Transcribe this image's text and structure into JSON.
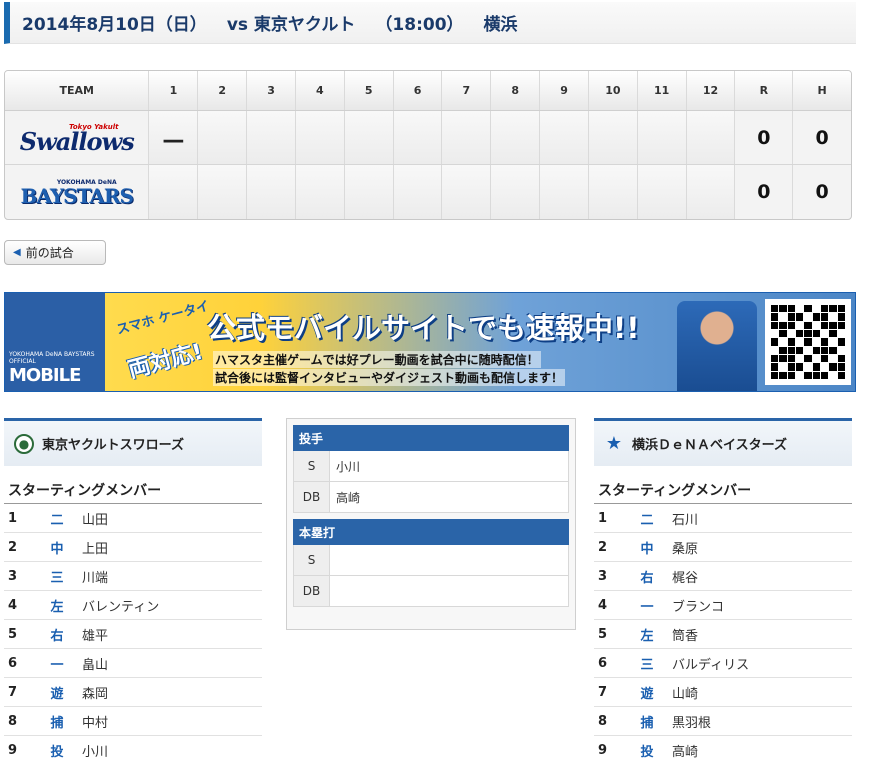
{
  "header": {
    "date": "2014年8月10日（日）",
    "opponent": "vs 東京ヤクルト",
    "time": "（18:00）",
    "venue": "横浜"
  },
  "scoreboard": {
    "columns": [
      "TEAM",
      "1",
      "2",
      "3",
      "4",
      "5",
      "6",
      "7",
      "8",
      "9",
      "10",
      "11",
      "12",
      "R",
      "H"
    ],
    "teams": [
      {
        "logo_top": "Tokyo Yakult",
        "logo_main": "Swallows",
        "innings": [
          "—",
          "",
          "",
          "",
          "",
          "",
          "",
          "",
          "",
          "",
          "",
          ""
        ],
        "runs": "0",
        "hits": "0"
      },
      {
        "logo_top": "YOKOHAMA DeNA",
        "logo_main": "BAYSTARS",
        "innings": [
          "",
          "",
          "",
          "",
          "",
          "",
          "",
          "",
          "",
          "",
          "",
          ""
        ],
        "runs": "0",
        "hits": "0"
      }
    ]
  },
  "prev_button": {
    "label": "前の試合"
  },
  "banner": {
    "mobile_small": "YOKOHAMA DeNA BAYSTARS OFFICIAL",
    "mobile_big": "MOBILE",
    "tag1": "スマホ ケータイ",
    "tag2": "両対応!",
    "headline": "公式モバイルサイトでも速報中!!",
    "line2": "ハマスタ主催ゲームでは好プレー動画を試合中に随時配信！",
    "line3": "試合後には監督インタビューやダイジェスト動画も配信します！"
  },
  "left_team": {
    "name": "東京ヤクルトスワローズ",
    "section": "スターティングメンバー",
    "lineup": [
      {
        "num": "1",
        "pos": "二",
        "name": "山田"
      },
      {
        "num": "2",
        "pos": "中",
        "name": "上田"
      },
      {
        "num": "3",
        "pos": "三",
        "name": "川端"
      },
      {
        "num": "4",
        "pos": "左",
        "name": "バレンティン"
      },
      {
        "num": "5",
        "pos": "右",
        "name": "雄平"
      },
      {
        "num": "6",
        "pos": "一",
        "name": "畠山"
      },
      {
        "num": "7",
        "pos": "遊",
        "name": "森岡"
      },
      {
        "num": "8",
        "pos": "捕",
        "name": "中村"
      },
      {
        "num": "9",
        "pos": "投",
        "name": "小川"
      }
    ]
  },
  "right_team": {
    "name": "横浜ＤｅＮＡベイスターズ",
    "section": "スターティングメンバー",
    "lineup": [
      {
        "num": "1",
        "pos": "二",
        "name": "石川"
      },
      {
        "num": "2",
        "pos": "中",
        "name": "桑原"
      },
      {
        "num": "3",
        "pos": "右",
        "name": "梶谷"
      },
      {
        "num": "4",
        "pos": "一",
        "name": "ブランコ"
      },
      {
        "num": "5",
        "pos": "左",
        "name": "筒香"
      },
      {
        "num": "6",
        "pos": "三",
        "name": "バルディリス"
      },
      {
        "num": "7",
        "pos": "遊",
        "name": "山崎"
      },
      {
        "num": "8",
        "pos": "捕",
        "name": "黒羽根"
      },
      {
        "num": "9",
        "pos": "投",
        "name": "高崎"
      }
    ]
  },
  "center": {
    "pitcher_head": "投手",
    "pitchers": [
      {
        "k": "S",
        "v": "小川"
      },
      {
        "k": "DB",
        "v": "高崎"
      }
    ],
    "homerun_head": "本塁打",
    "homeruns": [
      {
        "k": "S",
        "v": ""
      },
      {
        "k": "DB",
        "v": ""
      }
    ]
  },
  "colors": {
    "accent": "#2a64a8",
    "title": "#1a3a6a"
  }
}
